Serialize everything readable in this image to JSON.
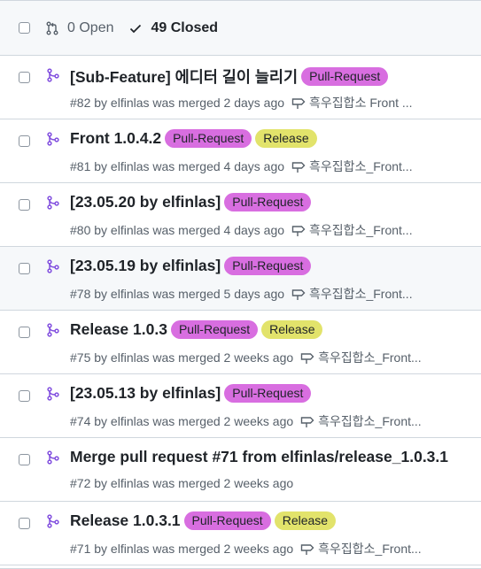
{
  "header": {
    "open_label": "0 Open",
    "closed_label": "49 Closed"
  },
  "labels": {
    "pull_request": "Pull-Request",
    "release": "Release"
  },
  "colors": {
    "pull_request_label": "#d86ee0",
    "release_label": "#e2e36b",
    "merged_icon": "#8250df"
  },
  "pull_requests": [
    {
      "title": "[Sub-Feature] 에디터 길이 늘리기",
      "meta": "#82 by elfinlas was merged 2 days ago",
      "milestone": "흑우집합소 Front ...",
      "labels": [
        "Pull-Request"
      ]
    },
    {
      "title": "Front 1.0.4.2",
      "meta": "#81 by elfinlas was merged 4 days ago",
      "milestone": "흑우집합소_Front...",
      "labels": [
        "Pull-Request",
        "Release"
      ]
    },
    {
      "title": "[23.05.20 by elfinlas]",
      "meta": "#80 by elfinlas was merged 4 days ago",
      "milestone": "흑우집합소_Front...",
      "labels": [
        "Pull-Request"
      ]
    },
    {
      "title": "[23.05.19 by elfinlas]",
      "meta": "#78 by elfinlas was merged 5 days ago",
      "milestone": "흑우집합소_Front...",
      "labels": [
        "Pull-Request"
      ]
    },
    {
      "title": "Release 1.0.3",
      "meta": "#75 by elfinlas was merged 2 weeks ago",
      "milestone": "흑우집합소_Front...",
      "labels": [
        "Pull-Request",
        "Release"
      ]
    },
    {
      "title": "[23.05.13 by elfinlas]",
      "meta": "#74 by elfinlas was merged 2 weeks ago",
      "milestone": "흑우집합소_Front...",
      "labels": [
        "Pull-Request"
      ]
    },
    {
      "title": "Merge pull request #71 from elfinlas/release_1.0.3.1",
      "meta": "#72 by elfinlas was merged 2 weeks ago",
      "milestone": "",
      "labels": []
    },
    {
      "title": "Release 1.0.3.1",
      "meta": "#71 by elfinlas was merged 2 weeks ago",
      "milestone": "흑우집합소_Front...",
      "labels": [
        "Pull-Request",
        "Release"
      ]
    }
  ]
}
